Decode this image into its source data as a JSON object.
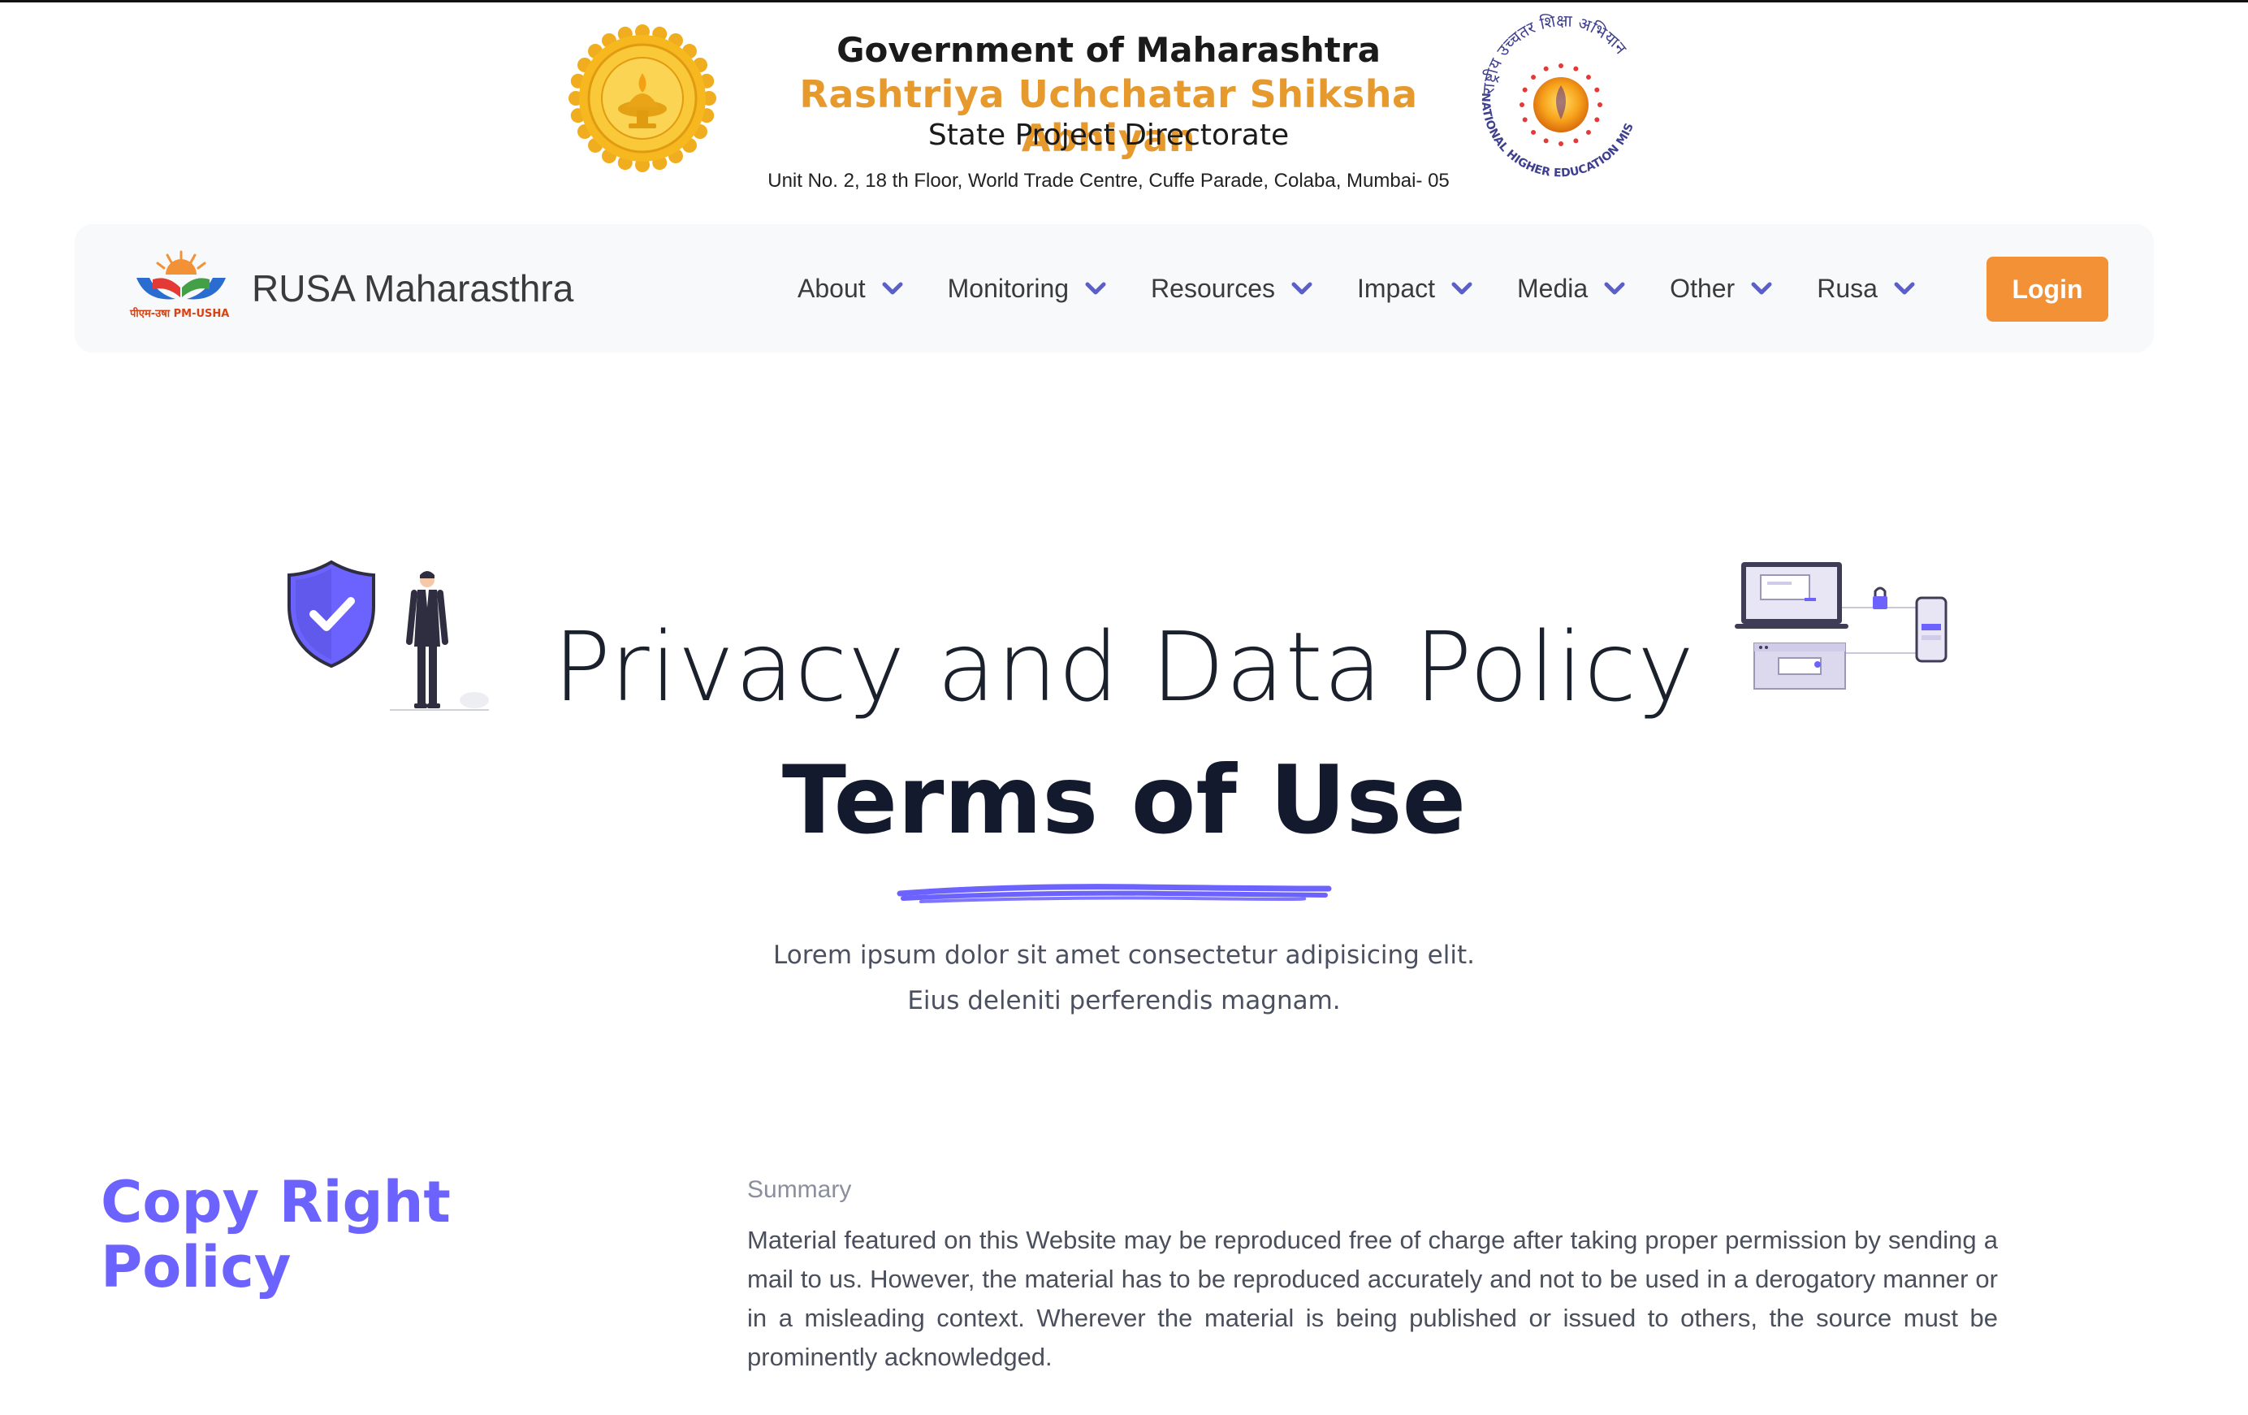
{
  "gov_header": {
    "title": "Government of Maharashtra",
    "scheme": "Rashtriya Uchchatar Shiksha Abhiyan",
    "directorate": "State Project Directorate",
    "address": "Unit No. 2, 18 th Floor, World Trade Centre, Cuffe Parade, Colaba, Mumbai- 05",
    "right_emblem_text": "राष्ट्रीय उच्चतर शिक्षा अभियान",
    "right_emblem_subtext": "NATIONAL HIGHER EDUCATION MISSION"
  },
  "navbar": {
    "brand_logo_text": "पीएम-उषा PM-USHA",
    "brand_name": "RUSA Maharasthra",
    "items": [
      {
        "label": "About"
      },
      {
        "label": "Monitoring"
      },
      {
        "label": "Resources"
      },
      {
        "label": "Impact"
      },
      {
        "label": "Media"
      },
      {
        "label": "Other"
      },
      {
        "label": "Rusa"
      }
    ],
    "login_label": "Login"
  },
  "hero": {
    "title": "Privacy and Data Policy",
    "subtitle": "Terms of Use",
    "description_line1": "Lorem ipsum dolor sit amet consectetur adipisicing elit.",
    "description_line2": "Eius deleniti perferendis magnam."
  },
  "policy": {
    "heading": "Copy Right Policy",
    "kicker": "Summary",
    "body": "Material featured on this Website may be reproduced free of charge after taking proper permission by sending a mail to us. However, the material has to be reproduced accurately and not to be used in a derogatory manner or in a misleading context. Wherever the material is being published or issued to others, the source must be prominently acknowledged."
  },
  "colors": {
    "accent_purple": "#6c63ff",
    "login_orange": "#f39137",
    "nav_chevron": "#5b5fc7",
    "scheme_orange": "#e69a2e",
    "navbar_bg": "#f8f9fb"
  },
  "icons": {
    "left_emblem": "maharashtra-seal-icon",
    "right_emblem": "nhem-sun-emblem-icon",
    "brand_logo": "pm-usha-logo-icon",
    "chevron": "chevron-down-icon",
    "hero_left": "security-shield-person-illustration",
    "hero_right": "devices-network-illustration"
  }
}
